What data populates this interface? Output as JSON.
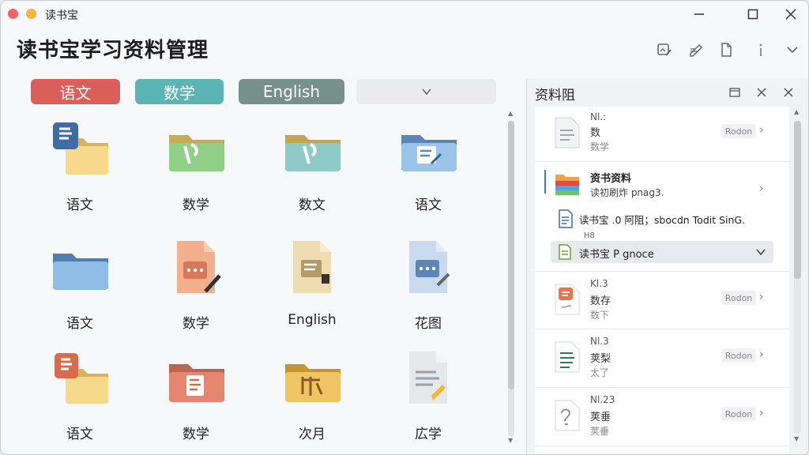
{
  "window": {
    "title": "读书宝"
  },
  "header": {
    "title": "读书宝学习资料管理"
  },
  "tabs": [
    {
      "label": "语文",
      "color": "#d9605a"
    },
    {
      "label": "数学",
      "color": "#5db4b4"
    },
    {
      "label": "English",
      "color": "#78908c"
    }
  ],
  "grid": {
    "items": [
      {
        "label": "语文",
        "icon": "folder-yellow-badge-icon"
      },
      {
        "label": "数学",
        "icon": "folder-green-icon"
      },
      {
        "label": "数文",
        "icon": "folder-teal-icon"
      },
      {
        "label": "语文",
        "icon": "folder-blue-edit-icon"
      },
      {
        "label": "语文",
        "icon": "folder-blue-icon"
      },
      {
        "label": "数学",
        "icon": "file-pen-orange-icon"
      },
      {
        "label": "English",
        "icon": "file-beige-icon"
      },
      {
        "label": "花图",
        "icon": "file-blue-icon"
      },
      {
        "label": "语文",
        "icon": "folder-yellow-badge-red-icon"
      },
      {
        "label": "数学",
        "icon": "folder-red-icon"
      },
      {
        "label": "次月",
        "icon": "folder-gold-icon"
      },
      {
        "label": "広学",
        "icon": "file-gray-icon"
      }
    ]
  },
  "panel": {
    "title": "资料阻",
    "rows": [
      {
        "t1": "Nl.:",
        "t2": "数",
        "t3": "数学",
        "button": "Rodon"
      },
      {
        "t1": "",
        "t2": "资书资料",
        "t3": "读初刷炸 pnag3.",
        "button": ""
      },
      {
        "t1": "",
        "t2": "读书宝 .0 阿阻；sbocdn  Todit SinG.",
        "t3": "",
        "button": ""
      },
      {
        "t1": "H8",
        "t2": "读书宝 P gnoce",
        "t3": "",
        "button": ""
      },
      {
        "t1": "Kl.3",
        "t2": "数存",
        "t3": "数下",
        "button": "Rodon"
      },
      {
        "t1": "Nl.3",
        "t2": "荚梨",
        "t3": "太了",
        "button": "Rodon"
      },
      {
        "t1": "Nl.23",
        "t2": "荚垂",
        "t3": "荚垂",
        "button": "Rodon"
      }
    ]
  }
}
